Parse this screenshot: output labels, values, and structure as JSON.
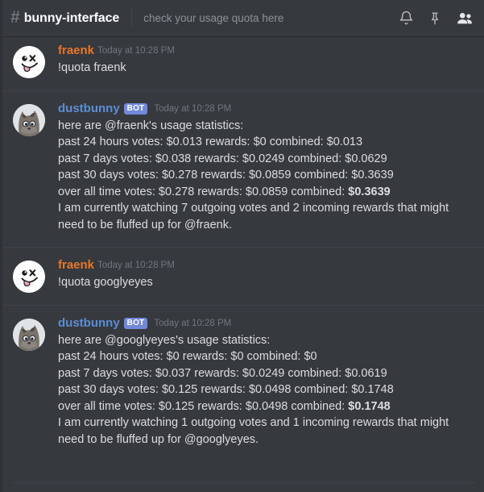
{
  "header": {
    "hash": "#",
    "channel_name": "bunny-interface",
    "topic": "check your usage quota here",
    "icons": [
      {
        "name": "notifications-bell-icon",
        "label": "bell"
      },
      {
        "name": "pinned-messages-icon",
        "label": "pin"
      },
      {
        "name": "member-list-icon",
        "label": "members"
      }
    ]
  },
  "colors": {
    "background": "#36393e",
    "header_background": "#36393e",
    "username_user": "#e8762a",
    "username_bot": "#5c8dd6",
    "bot_badge": "#7289da",
    "message_text": "#dcddde",
    "timestamp": "#72767d",
    "divider": "#40444b"
  },
  "messages": [
    {
      "author": "fraenk",
      "author_type": "user",
      "avatar": "fraenk-avatar",
      "badge": null,
      "timestamp": "Today at 10:28 PM",
      "lines": [
        {
          "text": "!quota fraenk",
          "bold_tail": ""
        }
      ]
    },
    {
      "author": "dustbunny",
      "author_type": "bot",
      "avatar": "dustbunny-avatar",
      "badge": "BOT",
      "timestamp": "Today at 10:28 PM",
      "lines": [
        {
          "text": "here are @fraenk's usage statistics:",
          "bold_tail": ""
        },
        {
          "text": "past 24 hours votes: $0.013 rewards: $0 combined: $0.013",
          "bold_tail": ""
        },
        {
          "text": "past 7 days votes: $0.038 rewards: $0.0249 combined: $0.0629",
          "bold_tail": ""
        },
        {
          "text": "past 30 days votes: $0.278 rewards: $0.0859 combined: $0.3639",
          "bold_tail": ""
        },
        {
          "text": "over all time votes: $0.278 rewards: $0.0859 combined: ",
          "bold_tail": "$0.3639"
        },
        {
          "text": "I am currently watching 7 outgoing votes and 2 incoming rewards that might need to be fluffed up for @fraenk.",
          "bold_tail": ""
        }
      ]
    },
    {
      "author": "fraenk",
      "author_type": "user",
      "avatar": "fraenk-avatar",
      "badge": null,
      "timestamp": "Today at 10:28 PM",
      "lines": [
        {
          "text": "!quota googlyeyes",
          "bold_tail": ""
        }
      ]
    },
    {
      "author": "dustbunny",
      "author_type": "bot",
      "avatar": "dustbunny-avatar",
      "badge": "BOT",
      "timestamp": "Today at 10:28 PM",
      "lines": [
        {
          "text": "here are @googlyeyes's usage statistics:",
          "bold_tail": ""
        },
        {
          "text": "past 24 hours votes: $0 rewards: $0 combined: $0",
          "bold_tail": ""
        },
        {
          "text": "past 7 days votes: $0.037 rewards: $0.0249 combined: $0.0619",
          "bold_tail": ""
        },
        {
          "text": "past 30 days votes: $0.125 rewards: $0.0498 combined: $0.1748",
          "bold_tail": ""
        },
        {
          "text": "over all time votes: $0.125 rewards: $0.0498 combined: ",
          "bold_tail": "$0.1748"
        },
        {
          "text": "I am currently watching 1 outgoing votes and 1 incoming rewards that might need to be fluffed up for @googlyeyes.",
          "bold_tail": ""
        }
      ]
    }
  ]
}
